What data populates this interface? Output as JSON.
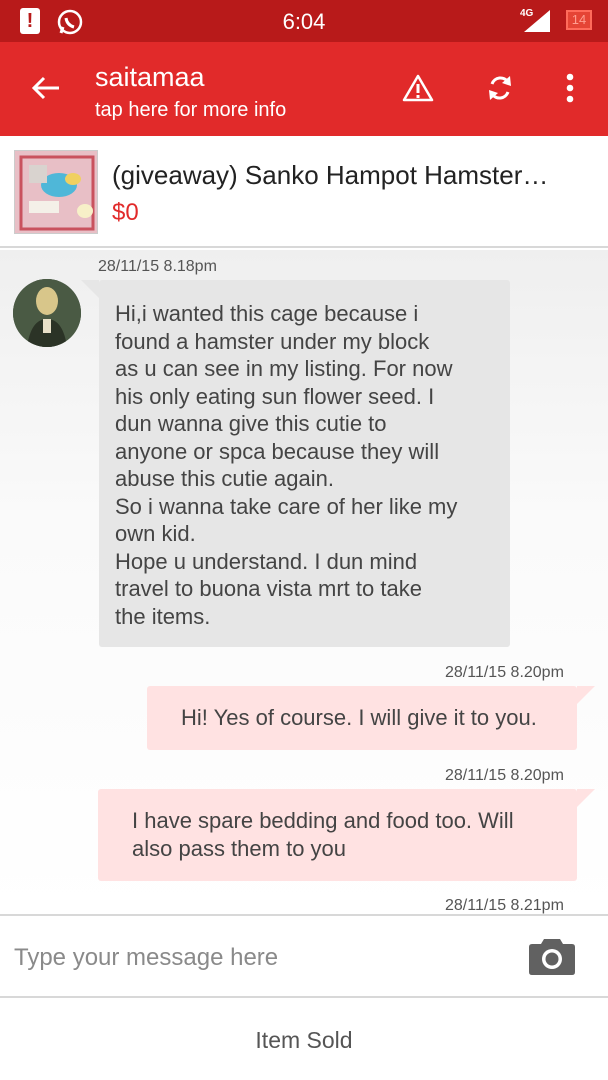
{
  "status_bar": {
    "time": "6:04",
    "network": "4G",
    "battery": "14",
    "icons": [
      "alert-icon",
      "whatsapp-icon",
      "signal-icon",
      "battery-icon"
    ]
  },
  "app_bar": {
    "title": "saitamaa",
    "subtitle": "tap here for more info",
    "icons": [
      "back-arrow-icon",
      "warning-icon",
      "refresh-icon",
      "more-vert-icon"
    ],
    "color": "#e12a2a"
  },
  "listing": {
    "title": "(giveaway) Sanko Hampot Hamster…",
    "price": "$0"
  },
  "messages": [
    {
      "timestamp": "28/11/15 8.18pm",
      "direction": "incoming",
      "lines": [
        "Hi,i wanted this cage because i",
        "found a hamster under my block",
        "as u can see in my listing. For now",
        "his only eating sun flower seed. I",
        "dun wanna give this cutie to",
        "anyone or spca because they will",
        "abuse this cutie again.",
        "So i wanna take care of her like my",
        "own kid.",
        "Hope u understand. I dun mind",
        "travel to buona vista mrt to take",
        "the items."
      ]
    },
    {
      "timestamp": "28/11/15 8.20pm",
      "direction": "outgoing",
      "lines": [
        "Hi! Yes of course. I will give it to you."
      ]
    },
    {
      "timestamp": "28/11/15 8.20pm",
      "direction": "outgoing",
      "lines": [
        "I have spare bedding and food too. Will",
        "also pass them to you"
      ]
    },
    {
      "timestamp": "28/11/15 8.21pm",
      "direction": "outgoing",
      "lines": []
    }
  ],
  "composer": {
    "placeholder": "Type your message here",
    "icon": "camera-icon"
  },
  "footer": {
    "label": "Item Sold"
  }
}
